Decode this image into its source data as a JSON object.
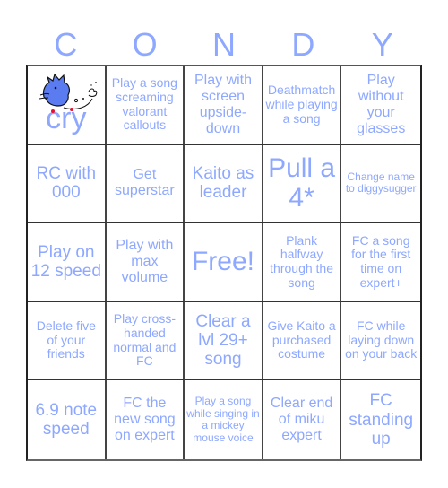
{
  "header": {
    "letters": [
      "C",
      "O",
      "N",
      "D",
      "Y"
    ]
  },
  "colors": {
    "text": "#8ea8ff",
    "grid": "#333333",
    "drawing_blue": "#5b7cf0",
    "drawing_red": "#e8102a"
  },
  "board": {
    "rows": [
      [
        {
          "text": "cry",
          "image": "blue-hedgehog-drawing-icon"
        },
        {
          "text": "Play a song screaming valorant callouts"
        },
        {
          "text": "Play with screen upside-down"
        },
        {
          "text": "Deathmatch while playing a song"
        },
        {
          "text": "Play without your glasses"
        }
      ],
      [
        {
          "text": "RC with 000"
        },
        {
          "text": "Get superstar"
        },
        {
          "text": "Kaito as leader"
        },
        {
          "text": "Pull a 4*"
        },
        {
          "text": "Change name to diggysugger"
        }
      ],
      [
        {
          "text": "Play on 12 speed"
        },
        {
          "text": "Play with max volume"
        },
        {
          "text": "Free!"
        },
        {
          "text": "Plank halfway through the song"
        },
        {
          "text": "FC a song for the first time on expert+"
        }
      ],
      [
        {
          "text": "Delete five of your friends"
        },
        {
          "text": "Play cross-handed normal and FC"
        },
        {
          "text": "Clear a lvl 29+ song"
        },
        {
          "text": "Give Kaito a purchased costume"
        },
        {
          "text": "FC while laying down on your back"
        }
      ],
      [
        {
          "text": "6.9 note speed"
        },
        {
          "text": "FC the new song on expert"
        },
        {
          "text": "Play a song while singing in a mickey mouse voice"
        },
        {
          "text": "Clear end of miku expert"
        },
        {
          "text": "FC standing up"
        }
      ]
    ]
  }
}
